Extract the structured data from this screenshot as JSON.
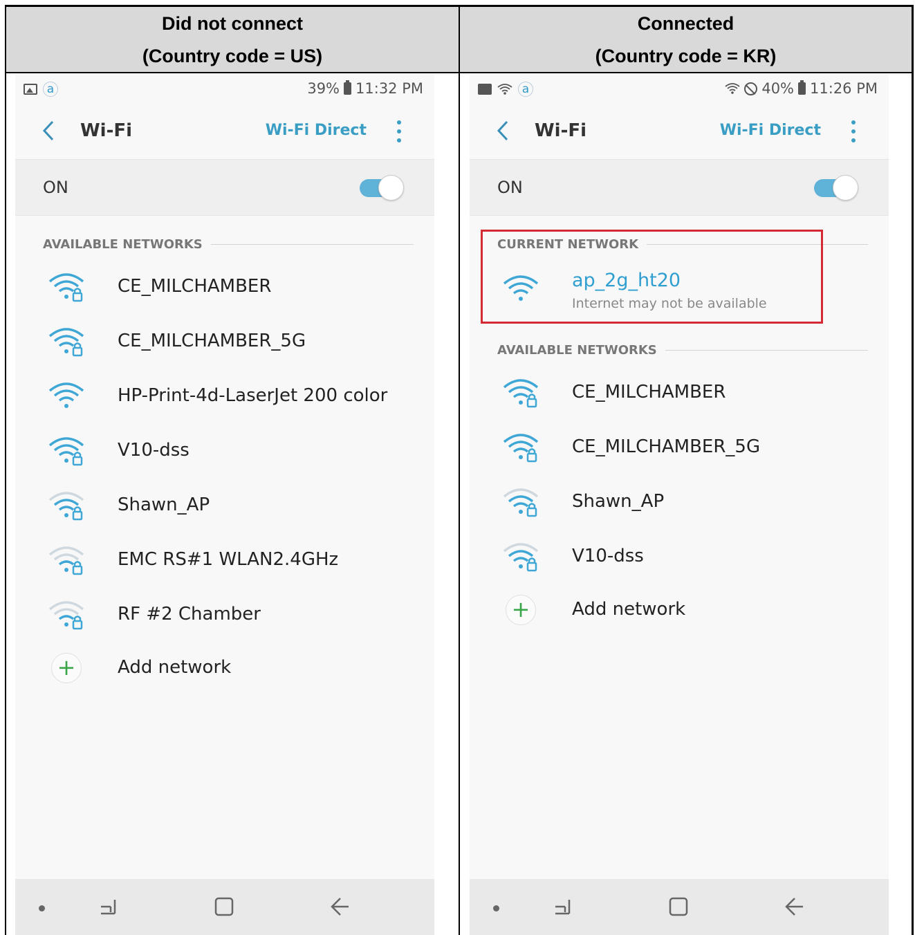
{
  "headers": {
    "left": {
      "line1": "Did not connect",
      "line2": "(Country code = US)"
    },
    "right": {
      "line1": "Connected",
      "line2": "(Country code = KR)"
    }
  },
  "left_phone": {
    "status": {
      "battery": "39%",
      "time": "11:32 PM",
      "at_icon": "a"
    },
    "toolbar": {
      "back_icon": "back-chevron-icon",
      "title": "Wi-Fi",
      "wifi_direct": "Wi-Fi Direct",
      "more_icon": "more-vert-icon"
    },
    "wifi_toggle": {
      "label": "ON",
      "state": "on"
    },
    "available_label": "AVAILABLE NETWORKS",
    "networks": [
      {
        "name": "CE_MILCHAMBER",
        "signal": "full",
        "secured": true
      },
      {
        "name": "CE_MILCHAMBER_5G",
        "signal": "full",
        "secured": true
      },
      {
        "name": "HP-Print-4d-LaserJet 200 color",
        "signal": "full",
        "secured": false
      },
      {
        "name": "V10-dss",
        "signal": "full",
        "secured": true
      },
      {
        "name": "Shawn_AP",
        "signal": "medium",
        "secured": true
      },
      {
        "name": "EMC RS#1 WLAN2.4GHz",
        "signal": "weak",
        "secured": true
      },
      {
        "name": "RF #2 Chamber",
        "signal": "weak",
        "secured": true
      }
    ],
    "add_network": "Add network"
  },
  "right_phone": {
    "status": {
      "battery": "40%",
      "time": "11:26 PM",
      "at_icon": "a"
    },
    "toolbar": {
      "back_icon": "back-chevron-icon",
      "title": "Wi-Fi",
      "wifi_direct": "Wi-Fi Direct",
      "more_icon": "more-vert-icon"
    },
    "wifi_toggle": {
      "label": "ON",
      "state": "on"
    },
    "current_label": "CURRENT NETWORK",
    "current_network": {
      "name": "ap_2g_ht20",
      "status": "Internet may not be available"
    },
    "available_label": "AVAILABLE NETWORKS",
    "networks": [
      {
        "name": "CE_MILCHAMBER",
        "signal": "full",
        "secured": true
      },
      {
        "name": "CE_MILCHAMBER_5G",
        "signal": "full",
        "secured": true
      },
      {
        "name": "Shawn_AP",
        "signal": "medium",
        "secured": true
      },
      {
        "name": "V10-dss",
        "signal": "medium",
        "secured": true
      }
    ],
    "add_network": "Add network"
  },
  "colors": {
    "accent": "#3a9ec4",
    "highlight_border": "#d42a34",
    "add_green": "#3aa64a"
  }
}
